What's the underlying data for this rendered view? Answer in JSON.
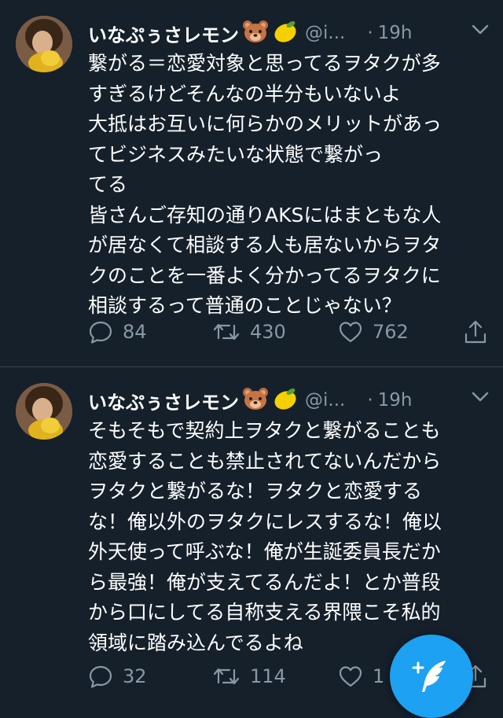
{
  "theme": {
    "background": "#15202b",
    "text": "#ffffff",
    "muted": "#8899a6",
    "divider": "#38444d",
    "accent": "#1da1f2"
  },
  "tweets": [
    {
      "display_name": "いなぷぅさレモン",
      "name_emoji": [
        "bear-face-icon",
        "lemon-icon"
      ],
      "handle": "@i...",
      "separator": "·",
      "time": "19h",
      "lines": [
        "繋がる＝恋愛対象と思ってるヲタクが多",
        "すぎるけどそんなの半分もいないよ",
        "大抵はお互いに何らかのメリットがあっ",
        "てビジネスみたいな状態で繋がっ",
        "てる",
        "皆さんご存知の通りAKSにはまともな人",
        "が居なくて相談する人も居ないからヲタ",
        "クのことを一番よく分かってるヲタクに",
        "相談するって普通のことじゃない？"
      ],
      "replies": "84",
      "retweets": "430",
      "likes": "762"
    },
    {
      "display_name": "いなぷぅさレモン",
      "name_emoji": [
        "bear-face-icon",
        "lemon-icon"
      ],
      "handle": "@i...",
      "separator": "·",
      "time": "19h",
      "lines": [
        "そもそもで契約上ヲタクと繋がることも",
        "恋愛することも禁止されてないんだから",
        "ヲタクと繋がるな！ヲタクと恋愛する",
        "な！俺以外のヲタクにレスするな！俺以",
        "外天使って呼ぶな！俺が生誕委員長だか",
        "ら最強！俺が支えてるんだよ！とか普段",
        "から口にしてる自称支える界隈こそ私的",
        "領域に踏み込んでるよね"
      ],
      "replies": "32",
      "retweets": "114",
      "likes": "1"
    }
  ],
  "fab": {
    "icon": "compose-tweet-icon"
  }
}
